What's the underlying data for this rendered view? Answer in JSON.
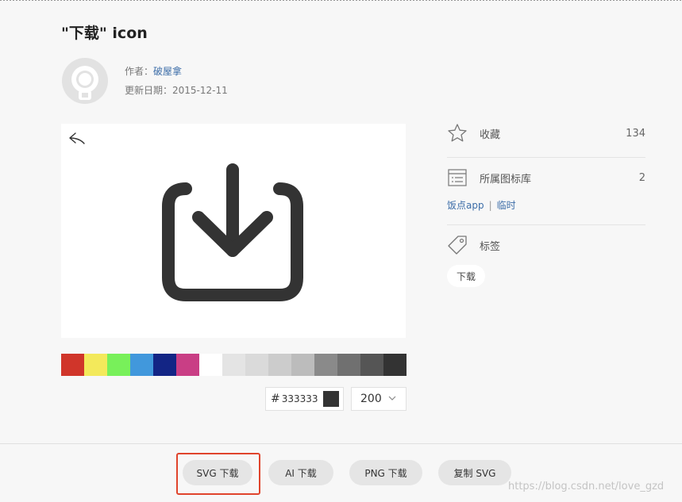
{
  "header": {
    "title": "\"下载\" icon"
  },
  "author": {
    "label": "作者：",
    "name": "破屋拿",
    "date_label": "更新日期：",
    "date": "2015-12-11"
  },
  "palette": {
    "colors": [
      "#d0352a",
      "#f3e95b",
      "#78f05a",
      "#4198dc",
      "#132585",
      "#c93e85",
      "#ffffff",
      "#e4e4e4",
      "#dadada",
      "#cccccc",
      "#bcbcbc",
      "#8a8a8a",
      "#707070",
      "#555555",
      "#333333"
    ],
    "hex_value": "333333",
    "hash": "#",
    "current_color": "#333333",
    "size": "200"
  },
  "sidebar": {
    "favorite": {
      "label": "收藏",
      "count": "134"
    },
    "library": {
      "label": "所属图标库",
      "count": "2"
    },
    "library_links": [
      "饭点app",
      "临时"
    ],
    "library_sep": "|",
    "tags": {
      "label": "标签",
      "items": [
        "下载"
      ]
    }
  },
  "actions": {
    "svg": "SVG 下载",
    "ai": "AI 下载",
    "png": "PNG 下载",
    "copy_svg": "复制 SVG"
  },
  "watermark": "https://blog.csdn.net/love_gzd"
}
